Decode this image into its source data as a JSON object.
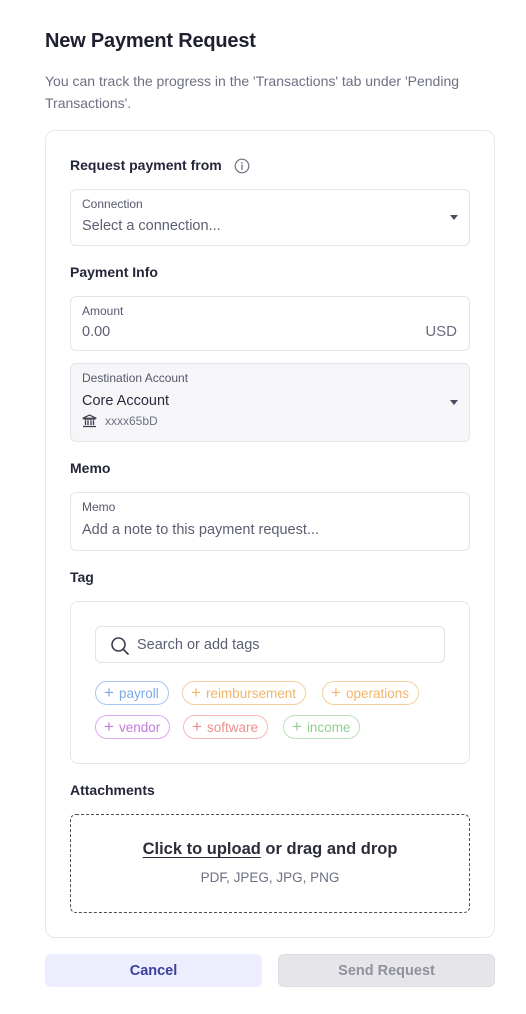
{
  "header": {
    "title": "New Payment Request",
    "subtitle": "You can track the progress in the 'Transactions' tab under 'Pending Transactions'."
  },
  "request_from": {
    "section_label": "Request payment from",
    "connection": {
      "label": "Connection",
      "placeholder": "Select a connection..."
    }
  },
  "payment_info": {
    "section_label": "Payment Info",
    "amount": {
      "label": "Amount",
      "placeholder": "0.00",
      "currency": "USD"
    },
    "destination": {
      "label": "Destination Account",
      "value": "Core Account",
      "account_number": "xxxx65bD"
    }
  },
  "memo": {
    "section_label": "Memo",
    "field": {
      "label": "Memo",
      "placeholder": "Add a note to this payment request..."
    }
  },
  "tags": {
    "section_label": "Tag",
    "search_placeholder": "Search or add tags",
    "items": [
      {
        "label": "payroll",
        "color": "#7fa8e8"
      },
      {
        "label": "reimbursement",
        "color": "#f2b56b"
      },
      {
        "label": "operations",
        "color": "#f2b56b"
      },
      {
        "label": "vendor",
        "color": "#c27be0"
      },
      {
        "label": "software",
        "color": "#ee8f8f"
      },
      {
        "label": "income",
        "color": "#8fcf8f"
      }
    ]
  },
  "attachments": {
    "section_label": "Attachments",
    "upload_link": "Click to upload",
    "upload_rest": "or drag and drop",
    "formats": "PDF, JPEG, JPG, PNG"
  },
  "actions": {
    "cancel_label": "Cancel",
    "send_label": "Send Request"
  },
  "colors": {
    "accent": "#3a3d9e",
    "cancel_bg": "#eceefe",
    "disabled_bg": "#e6e6ea"
  }
}
